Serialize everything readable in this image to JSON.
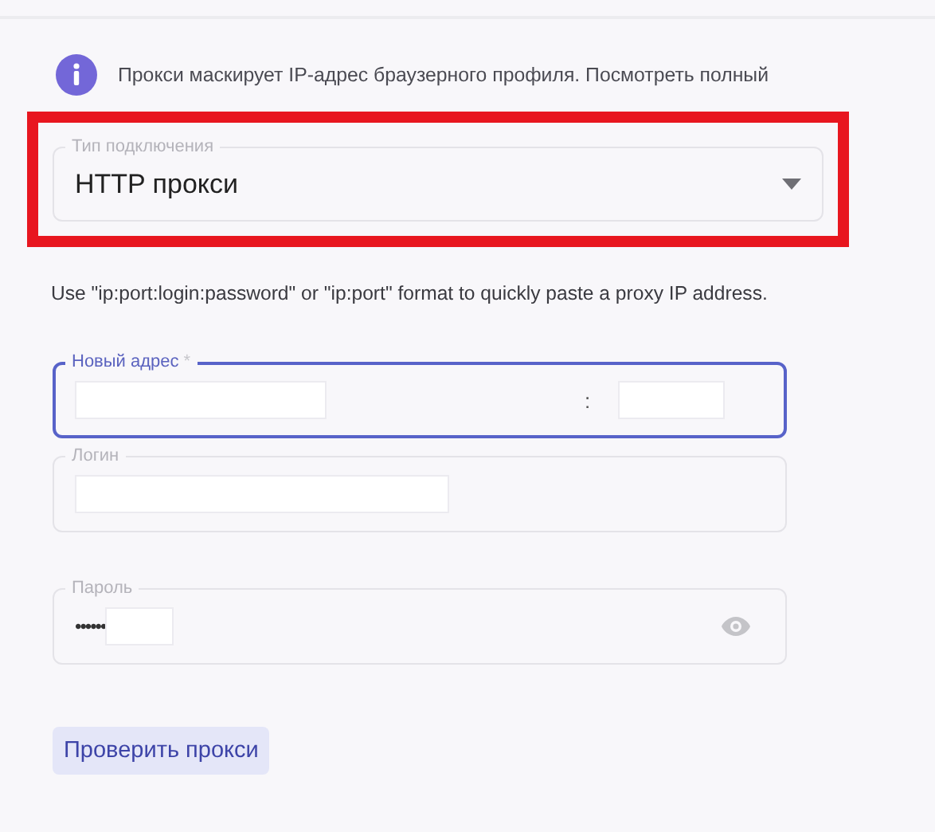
{
  "info": {
    "text": "Прокси маскирует IP-адрес браузерного профиля. Посмотреть полный"
  },
  "connection_type": {
    "label": "Тип подключения",
    "value": "HTTP прокси",
    "highlighted": true
  },
  "hint": "Use \"ip:port:login:password\" or \"ip:port\" format to quickly paste a proxy IP address.",
  "fields": [
    {
      "kind": "address",
      "label": "Новый адрес",
      "required_mark": "*",
      "focused": true,
      "separator": ":"
    },
    {
      "kind": "text",
      "label": "Логин",
      "focused": false
    },
    {
      "kind": "password",
      "label": "Пароль",
      "focused": false,
      "value": "••••••"
    }
  ],
  "check_button": "Проверить прокси"
}
